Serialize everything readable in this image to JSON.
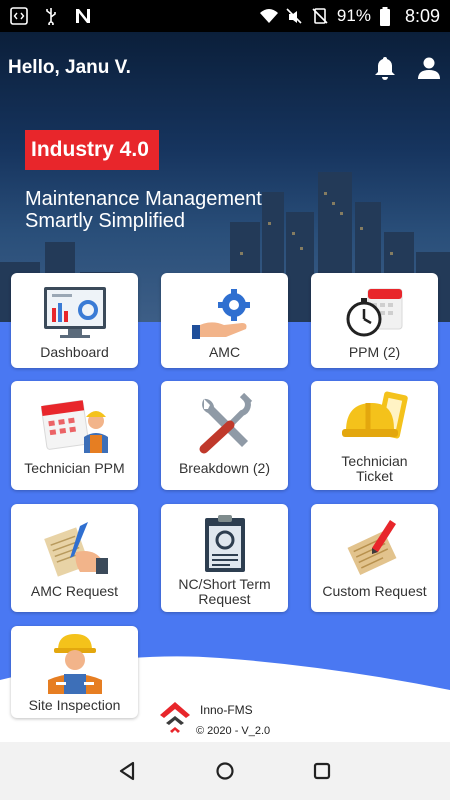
{
  "status_bar": {
    "battery": "91%",
    "time": "8:09",
    "left_icons": [
      "code-icon",
      "usb-icon",
      "n-app-icon"
    ],
    "right_icons": [
      "wifi-icon",
      "mute-icon",
      "no-sim-icon",
      "battery-icon"
    ]
  },
  "header": {
    "greeting": "Hello, Janu V.",
    "icons": [
      "bell-icon",
      "profile-icon"
    ]
  },
  "hero": {
    "badge": "Industry 4.0",
    "tagline_line1": "Maintenance Management",
    "tagline_line2": "Smartly Simplified"
  },
  "tiles": [
    {
      "label": "Dashboard",
      "icon": "dashboard-icon"
    },
    {
      "label": "AMC",
      "icon": "amc-icon"
    },
    {
      "label": "PPM (2)",
      "icon": "ppm-icon"
    },
    {
      "label": "Technician PPM",
      "icon": "technician-ppm-icon"
    },
    {
      "label": "Breakdown (2)",
      "icon": "breakdown-icon"
    },
    {
      "label_line1": "Technician",
      "label_line2": "Ticket",
      "icon": "technician-ticket-icon"
    },
    {
      "label": "AMC Request",
      "icon": "amc-request-icon"
    },
    {
      "label_line1": "NC/Short Term",
      "label_line2": "Request",
      "icon": "nc-request-icon"
    },
    {
      "label": "Custom Request",
      "icon": "custom-request-icon"
    },
    {
      "label": "Site Inspection",
      "icon": "site-inspection-icon"
    }
  ],
  "footer": {
    "brand": "Inno-FMS",
    "version": "© 2020 -  V_2.0"
  },
  "colors": {
    "accent_red": "#e8262b",
    "blue_background": "#4a78f2"
  },
  "nav": [
    "back-icon",
    "home-icon",
    "recents-icon"
  ]
}
